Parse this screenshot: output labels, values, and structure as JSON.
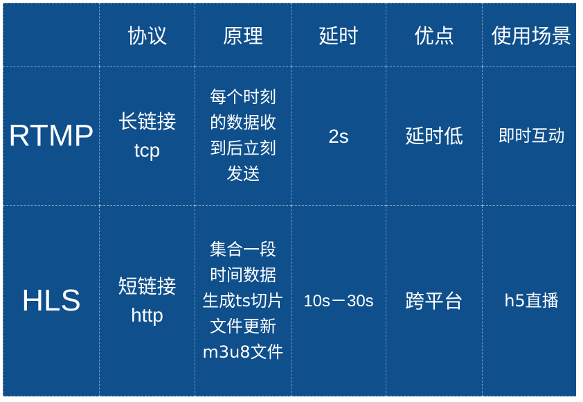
{
  "header": {
    "corner": "",
    "protocol": "协议",
    "principle": "原理",
    "latency": "延时",
    "advantage": "优点",
    "use_case": "使用场景"
  },
  "rows": [
    {
      "name": "RTMP",
      "protocol": [
        "长链接",
        "tcp"
      ],
      "principle": [
        "每个时刻",
        "的数据收",
        "到后立刻",
        "发送"
      ],
      "latency": "2s",
      "advantage": "延时低",
      "use_case": "即时互动"
    },
    {
      "name": "HLS",
      "protocol": [
        "短链接",
        "http"
      ],
      "principle": [
        "集合一段",
        "时间数据",
        "生成ts切片",
        "文件更新",
        "m3u8文件"
      ],
      "latency": "10s－30s",
      "advantage": "跨平台",
      "use_case": "h5直播"
    }
  ],
  "colors": {
    "background": "#0f4f8c",
    "text": "#ffffff",
    "grid": "#ffffff"
  }
}
